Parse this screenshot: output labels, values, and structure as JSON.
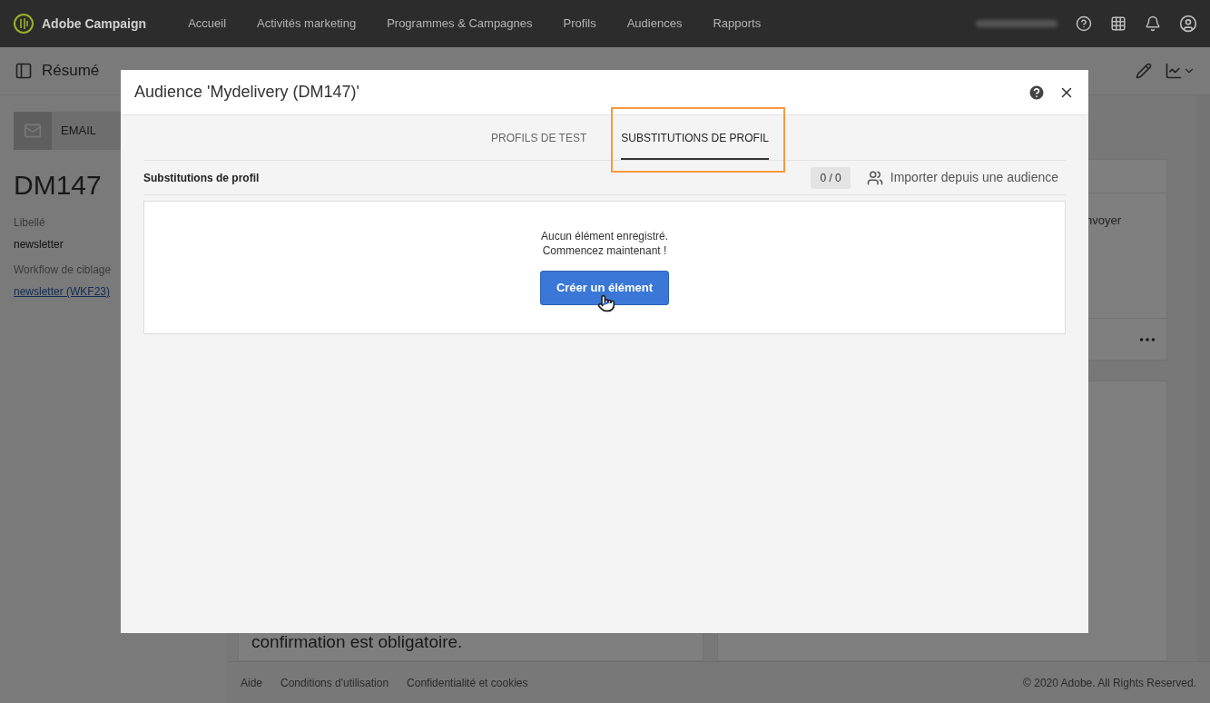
{
  "nav": {
    "brand": "Adobe Campaign",
    "items": [
      {
        "label": "Accueil"
      },
      {
        "label": "Activités marketing"
      },
      {
        "label": "Programmes & Campagnes"
      },
      {
        "label": "Profils"
      },
      {
        "label": "Audiences"
      },
      {
        "label": "Rapports"
      }
    ]
  },
  "toolbar": {
    "title": "Résumé"
  },
  "sidebar": {
    "channel": "EMAIL",
    "id": "DM147",
    "fields": [
      {
        "label": "Libellé",
        "value": "newsletter",
        "kind": "text"
      },
      {
        "label": "Workflow de ciblage",
        "value": "newsletter (WKF23)",
        "kind": "link"
      }
    ]
  },
  "background_cards": {
    "right_text": "nvoyer",
    "left_text": "confirmation est obligatoire."
  },
  "footer": {
    "links": [
      "Aide",
      "Conditions d'utilisation",
      "Confidentialité et cookies"
    ],
    "copyright": "© 2020 Adobe. All Rights Reserved."
  },
  "dialog": {
    "title": "Audience 'Mydelivery (DM147)'",
    "tabs": [
      {
        "label": "PROFILS DE TEST",
        "selected": false,
        "highlighted": false
      },
      {
        "label": "SUBSTITUTIONS DE PROFIL",
        "selected": true,
        "highlighted": true
      }
    ],
    "section": {
      "title": "Substitutions de profil",
      "count": "0 / 0",
      "import_button": "Importer depuis une audience"
    },
    "empty": {
      "lines": [
        "Aucun élément enregistré.",
        "Commencez maintenant !"
      ],
      "button": "Créer un élément"
    }
  }
}
